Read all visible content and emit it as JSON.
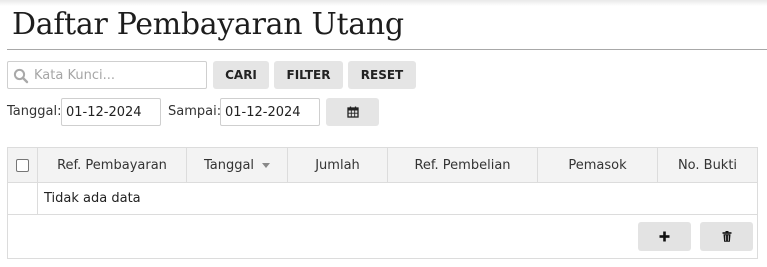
{
  "page": {
    "title": "Daftar Pembayaran Utang"
  },
  "search": {
    "placeholder": "Kata Kunci...",
    "value": "",
    "icon": "search-icon"
  },
  "toolbar": {
    "cari_label": "CARI",
    "filter_label": "FILTER",
    "reset_label": "RESET"
  },
  "date_filter": {
    "from_label": "Tanggal:",
    "from_value": "01-12-2024",
    "to_label": "Sampai:",
    "to_value": "01-12-2024",
    "calendar_icon": "calendar-icon"
  },
  "table": {
    "columns": [
      "Ref. Pembayaran",
      "Tanggal",
      "Jumlah",
      "Ref. Pembelian",
      "Pemasok",
      "No. Bukti"
    ],
    "sorted_column": "Tanggal",
    "sort_direction": "descending",
    "empty_message": "Tidak ada data",
    "rows": []
  },
  "actions": {
    "add_icon": "plus-icon",
    "delete_icon": "trash-icon"
  },
  "colors": {
    "button_bg": "#e5e5e5",
    "header_bg": "#f3f3f3",
    "border": "#dcdcdc",
    "title_rule": "#a8a8a8"
  }
}
